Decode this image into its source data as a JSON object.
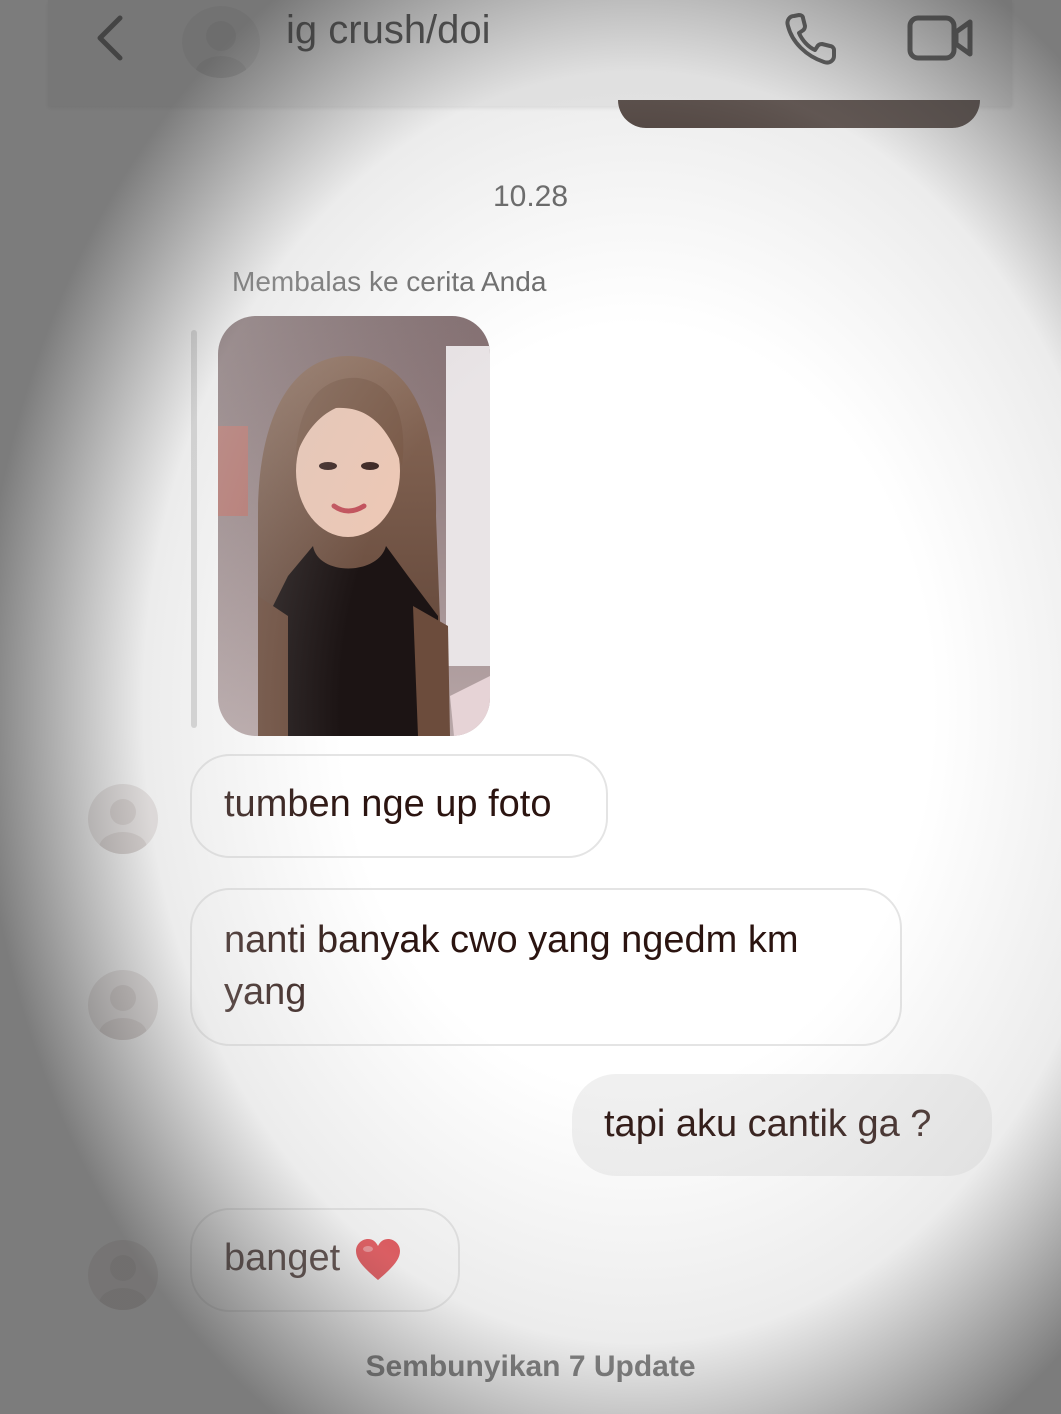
{
  "header": {
    "contact_name": "ig crush/doi",
    "back_icon": "chevron-left-icon",
    "call_icon": "phone-icon",
    "video_icon": "video-camera-icon"
  },
  "chat": {
    "timestamp": "10.28",
    "reply_label": "Membalas ke cerita Anda",
    "messages": [
      {
        "from": "contact",
        "text": "tumben nge up foto"
      },
      {
        "from": "contact",
        "text": "nanti banyak cwo yang ngedm km yang"
      },
      {
        "from": "me",
        "text": "tapi aku cantik ga ?"
      },
      {
        "from": "contact",
        "text": "banget",
        "emoji": "heart-icon"
      }
    ],
    "hide_updates": "Sembunyikan 7 Update"
  },
  "colors": {
    "header_bg": "#ececec",
    "incoming_bubble_border": "#e4e4e4",
    "outgoing_bubble_bg": "#f0f0f0",
    "heart": "#e3262d"
  }
}
